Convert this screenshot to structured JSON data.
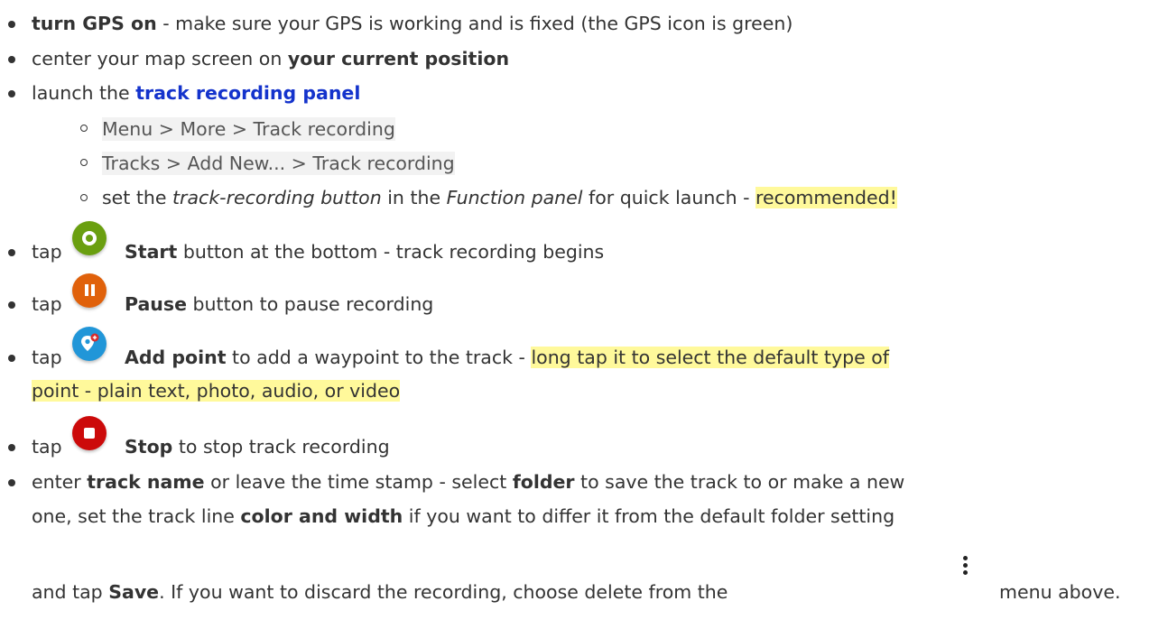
{
  "items": {
    "gps": {
      "bold": "turn GPS on",
      "rest": " - make sure your GPS is working and is fixed (the GPS icon is green)"
    },
    "center": {
      "pre": "center your map screen on ",
      "bold": "your current position"
    },
    "launch": {
      "pre": "launch the ",
      "link": "track recording panel",
      "sub": {
        "menu_path": "Menu > More > Track recording",
        "tracks_path": "Tracks > Add New... > Track recording",
        "set": {
          "pre": "set the ",
          "em1": "track-recording button",
          "mid": " in the ",
          "em2": "Function panel",
          "post": " for quick launch - ",
          "highlight": "recommended!"
        }
      }
    },
    "start": {
      "pre": "tap",
      "bold": "Start",
      "rest": " button at the bottom - track recording begins",
      "icon": "start-record-icon",
      "color": "#6a9f10"
    },
    "pause": {
      "pre": "tap",
      "bold": "Pause",
      "rest": " button to pause recording",
      "icon": "pause-record-icon",
      "color": "#e0610b"
    },
    "add_point": {
      "pre": "tap",
      "bold": "Add point",
      "rest": " to add a waypoint to the track - ",
      "highlight_1": "long tap it to select the default type of",
      "highlight_2": "point - plain text, photo, audio, or video",
      "icon": "add-point-icon",
      "color": "#2196d8"
    },
    "stop": {
      "pre": "tap",
      "bold": "Stop",
      "rest": " to stop track recording",
      "icon": "stop-record-icon",
      "color": "#cc0a0a"
    },
    "enter": {
      "pre": "enter ",
      "b1": "track name",
      "t1": " or leave the time stamp - select ",
      "b2": "folder",
      "t2": " to save the track to or make a new",
      "line2_pre": "one, set the track line ",
      "b3": "color and width",
      "t3": " if you want to differ it from the default folder setting",
      "line3_pre": "and tap ",
      "b4": "Save",
      "t4": ". If you want to discard the recording, choose delete from the",
      "t5": "menu above.",
      "icon": "more-vert-icon"
    }
  }
}
